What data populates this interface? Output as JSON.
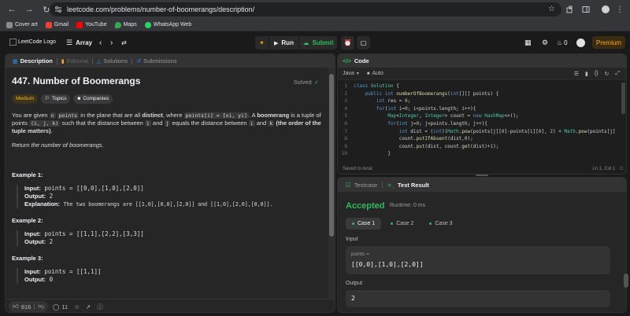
{
  "browser": {
    "url": "leetcode.com/problems/number-of-boomerangs/description/",
    "bookmarks": [
      {
        "label": "Cover art",
        "color": "#8b8b8b"
      },
      {
        "label": "Gmail",
        "color": "#ea4335"
      },
      {
        "label": "YouTube",
        "color": "#ff0000"
      },
      {
        "label": "Maps",
        "color": "#34a853"
      },
      {
        "label": "WhatsApp Web",
        "color": "#25d366"
      }
    ]
  },
  "header": {
    "logo_alt": "LeetCode Logo",
    "problem_list": "Array",
    "run_label": "Run",
    "submit_label": "Submit",
    "streak_count": "0",
    "premium_label": "Premium"
  },
  "left_tabs": [
    "Description",
    "Editorial",
    "Solutions",
    "Submissions"
  ],
  "problem": {
    "title": "447. Number of Boomerangs",
    "status": "Solved",
    "chips": [
      "Medium",
      "Topics",
      "Companies"
    ],
    "desc": {
      "p1": "You are given ",
      "n": "n",
      "points_code": "points",
      "p2": " in the plane that are all ",
      "distinct": "distinct",
      "p3": ", where ",
      "pi_code": "points[i] = [xi, yi]",
      "p4": ". A ",
      "boomerang": "boomerang",
      "p5": " is a tuple of points ",
      "ijk_code": "(i, j, k)",
      "p6": " such that the distance between ",
      "i_code": "i",
      "p7": " and ",
      "j_code": "j",
      "p8": " equals the distance between ",
      "i2_code": "i",
      "p9": " and ",
      "k_code": "k",
      "p10": " ",
      "order": "(the order of the tuple matters)",
      "p11": ".",
      "return_pre": "Return ",
      "return_it": "the number of boomerangs",
      "return_post": "."
    },
    "examples": [
      {
        "title": "Example 1:",
        "input_label": "Input:",
        "input": "points = [[0,0],[1,0],[2,0]]",
        "output_label": "Output:",
        "output": "2",
        "explanation_label": "Explanation:",
        "explanation": "The two boomerangs are [[1,0],[0,0],[2,0]] and [[1,0],[2,0],[0,0]]."
      },
      {
        "title": "Example 2:",
        "input_label": "Input:",
        "input": "points = [[1,1],[2,2],[3,3]]",
        "output_label": "Output:",
        "output": "2"
      },
      {
        "title": "Example 3:",
        "input_label": "Input:",
        "input": "points = [[1,1]]",
        "output_label": "Output:",
        "output": "0"
      }
    ],
    "likes": "816",
    "comments": "11"
  },
  "code_panel": {
    "title": "Code",
    "language": "Java",
    "mode": "Auto",
    "lines": [
      {
        "n": "1",
        "text": "class Solution {"
      },
      {
        "n": "2",
        "text": "    public int numberOfBoomerangs(int[][] points) {"
      },
      {
        "n": "3",
        "text": "        int res = 0;"
      },
      {
        "n": "4",
        "text": "        for(int i=0; i<points.length; i++){"
      },
      {
        "n": "5",
        "text": "            Map<Integer, Integer> count = new HashMap<>();"
      },
      {
        "n": "6",
        "text": "            for(int j=0; j<points.length; j++){"
      },
      {
        "n": "7",
        "text": "                int dist = (int)(Math.pow(points[j][0]-points[i][0], 2) + Math.pow(points[j]"
      },
      {
        "n": "8",
        "text": "                count.putIfAbsent(dist,0);"
      },
      {
        "n": "9",
        "text": "                count.put(dist, count.get(dist)+1);"
      },
      {
        "n": "10",
        "text": "            }"
      }
    ],
    "saved": "Saved to local",
    "cursor": "Ln 1, Col 1"
  },
  "result_panel": {
    "tabs": [
      "Testcase",
      "Test Result"
    ],
    "status": "Accepted",
    "runtime": "Runtime: 0 ms",
    "cases": [
      "Case 1",
      "Case 2",
      "Case 3"
    ],
    "input_label": "Input",
    "input_key": "points =",
    "input_value": "[[0,0],[1,0],[2,0]]",
    "output_label": "Output",
    "output_value": "2"
  }
}
